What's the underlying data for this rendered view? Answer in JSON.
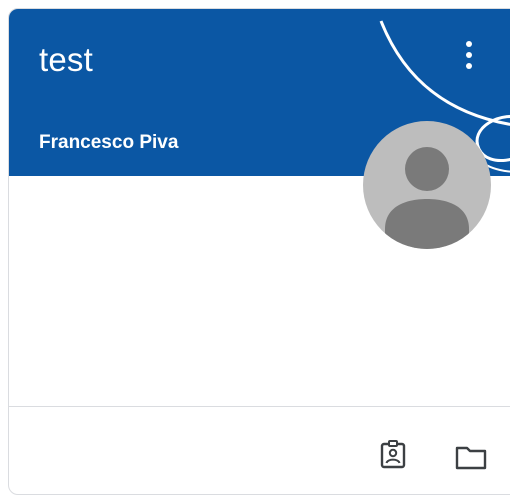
{
  "card": {
    "title": "test",
    "teacher": "Francesco Piva",
    "header_color": "#0b57a4",
    "icons": {
      "menu": "more-vertical-icon",
      "avatar": "person-avatar-icon",
      "assignments": "assignment-ind-icon",
      "folder": "folder-icon"
    }
  }
}
